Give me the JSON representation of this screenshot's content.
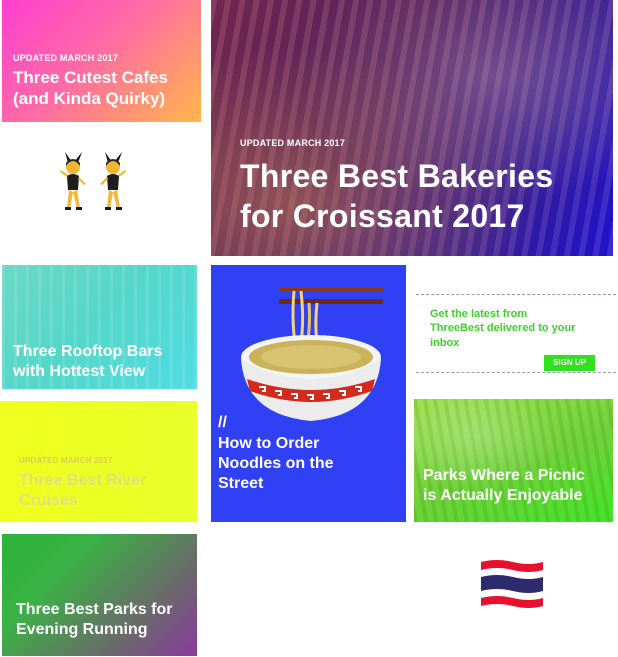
{
  "cards": {
    "cafes": {
      "updated": "UPDATED MARCH 2017",
      "title_line1": "Three Cutest Cafes",
      "title_line2": "(and Kinda Quirky)"
    },
    "bakery": {
      "updated": "UPDATED MARCH 2017",
      "title_line1": "Three Best Bakeries",
      "title_line2": "for Croissant 2017"
    },
    "rooftop": {
      "title_line1": "Three Rooftop Bars",
      "title_line2": "with Hottest View"
    },
    "noodles": {
      "prefix": "//",
      "title_line1": "How to Order",
      "title_line2": "Noodles on the",
      "title_line3": "Street"
    },
    "river": {
      "updated": "UPDATED MARCH 2017",
      "title_line1": "Three Best River",
      "title_line2": "Cruises"
    },
    "parks": {
      "title_line1": "Parks Where a Picnic",
      "title_line2": "is Actually Enjoyable"
    },
    "running": {
      "title_line1": "Three Best Parks for",
      "title_line2": "Evening Running"
    }
  },
  "newsletter": {
    "message_line1": "Get the latest from",
    "message_line2": "ThreeBest delivered to your",
    "message_line3": "inbox",
    "button_label": "SIGN UP"
  },
  "icons": {
    "dancers": "women-with-bunny-ears-emoji",
    "bowl": "steaming-bowl-emoji",
    "flag": "flag-thailand-emoji"
  },
  "colors": {
    "newsletter_green": "#3bd428",
    "noodles_blue": "#2f40f5"
  }
}
